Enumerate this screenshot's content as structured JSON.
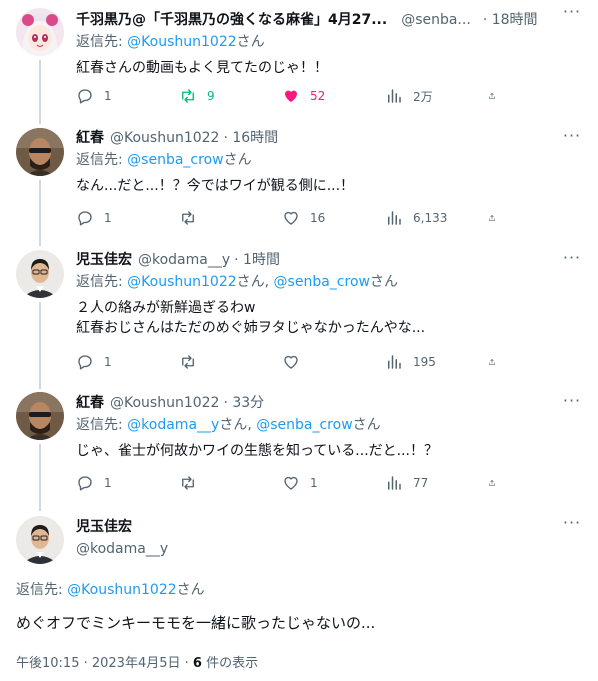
{
  "tweets": [
    {
      "name": "千羽黒乃@「千羽黒乃の強くなる麻雀」4月27...",
      "handle": "@senba...",
      "time": "18時間",
      "reply_prefix": "返信先: ",
      "reply_to": "@Koushun1022",
      "reply_suffix": "さん",
      "text": "紅春さんの動画もよく見てたのじゃ！！",
      "replies": "1",
      "retweets": "9",
      "likes": "52",
      "views": "2万"
    },
    {
      "name": "紅春",
      "handle": "@Koushun1022",
      "time": "· 16時間",
      "reply_prefix": "返信先: ",
      "reply_to": "@senba_crow",
      "reply_suffix": "さん",
      "text": "なん...だと...！？今ではワイが観る側に...！",
      "replies": "1",
      "retweets": "",
      "likes": "16",
      "views": "6,133"
    },
    {
      "name": "児玉佳宏",
      "handle": "@kodama__y",
      "time": "· 1時間",
      "reply_prefix": "返信先: ",
      "reply_to": "@Koushun1022",
      "reply_mid": "さん, ",
      "reply_to2": "@senba_crow",
      "reply_suffix": "さん",
      "text_line1": "２人の絡みが新鮮過ぎるわw",
      "text_line2": "紅春おじさんはただのめぐ姉ヲタじゃなかったんやな...",
      "replies": "1",
      "retweets": "",
      "likes": "",
      "views": "195"
    },
    {
      "name": "紅春",
      "handle": "@Koushun1022",
      "time": "· 33分",
      "reply_prefix": "返信先: ",
      "reply_to": "@kodama__y",
      "reply_mid": "さん, ",
      "reply_to2": "@senba_crow",
      "reply_suffix": "さん",
      "text": "じゃ、雀士が何故かワイの生態を知っている...だと...！？",
      "replies": "1",
      "retweets": "",
      "likes": "1",
      "views": "77"
    }
  ],
  "main": {
    "name": "児玉佳宏",
    "handle": "@kodama__y",
    "reply_prefix": "返信先: ",
    "reply_to": "@Koushun1022",
    "reply_suffix": "さん",
    "text": "めぐオフでミンキーモモを一緒に歌ったじゃないの...",
    "timestamp": "午後10:15 · 2023年4月5日 · ",
    "view_count": "6",
    "view_label": " 件の表示"
  },
  "colors": {
    "accent": "#1d9bf0",
    "retweet_active": "#00ba7c",
    "like_active": "#f91880",
    "secondary_text": "#536471"
  },
  "icons": {
    "reply": "reply-icon",
    "retweet": "retweet-icon",
    "like": "heart-icon",
    "views": "views-icon",
    "share": "share-icon",
    "more": "more-icon"
  }
}
